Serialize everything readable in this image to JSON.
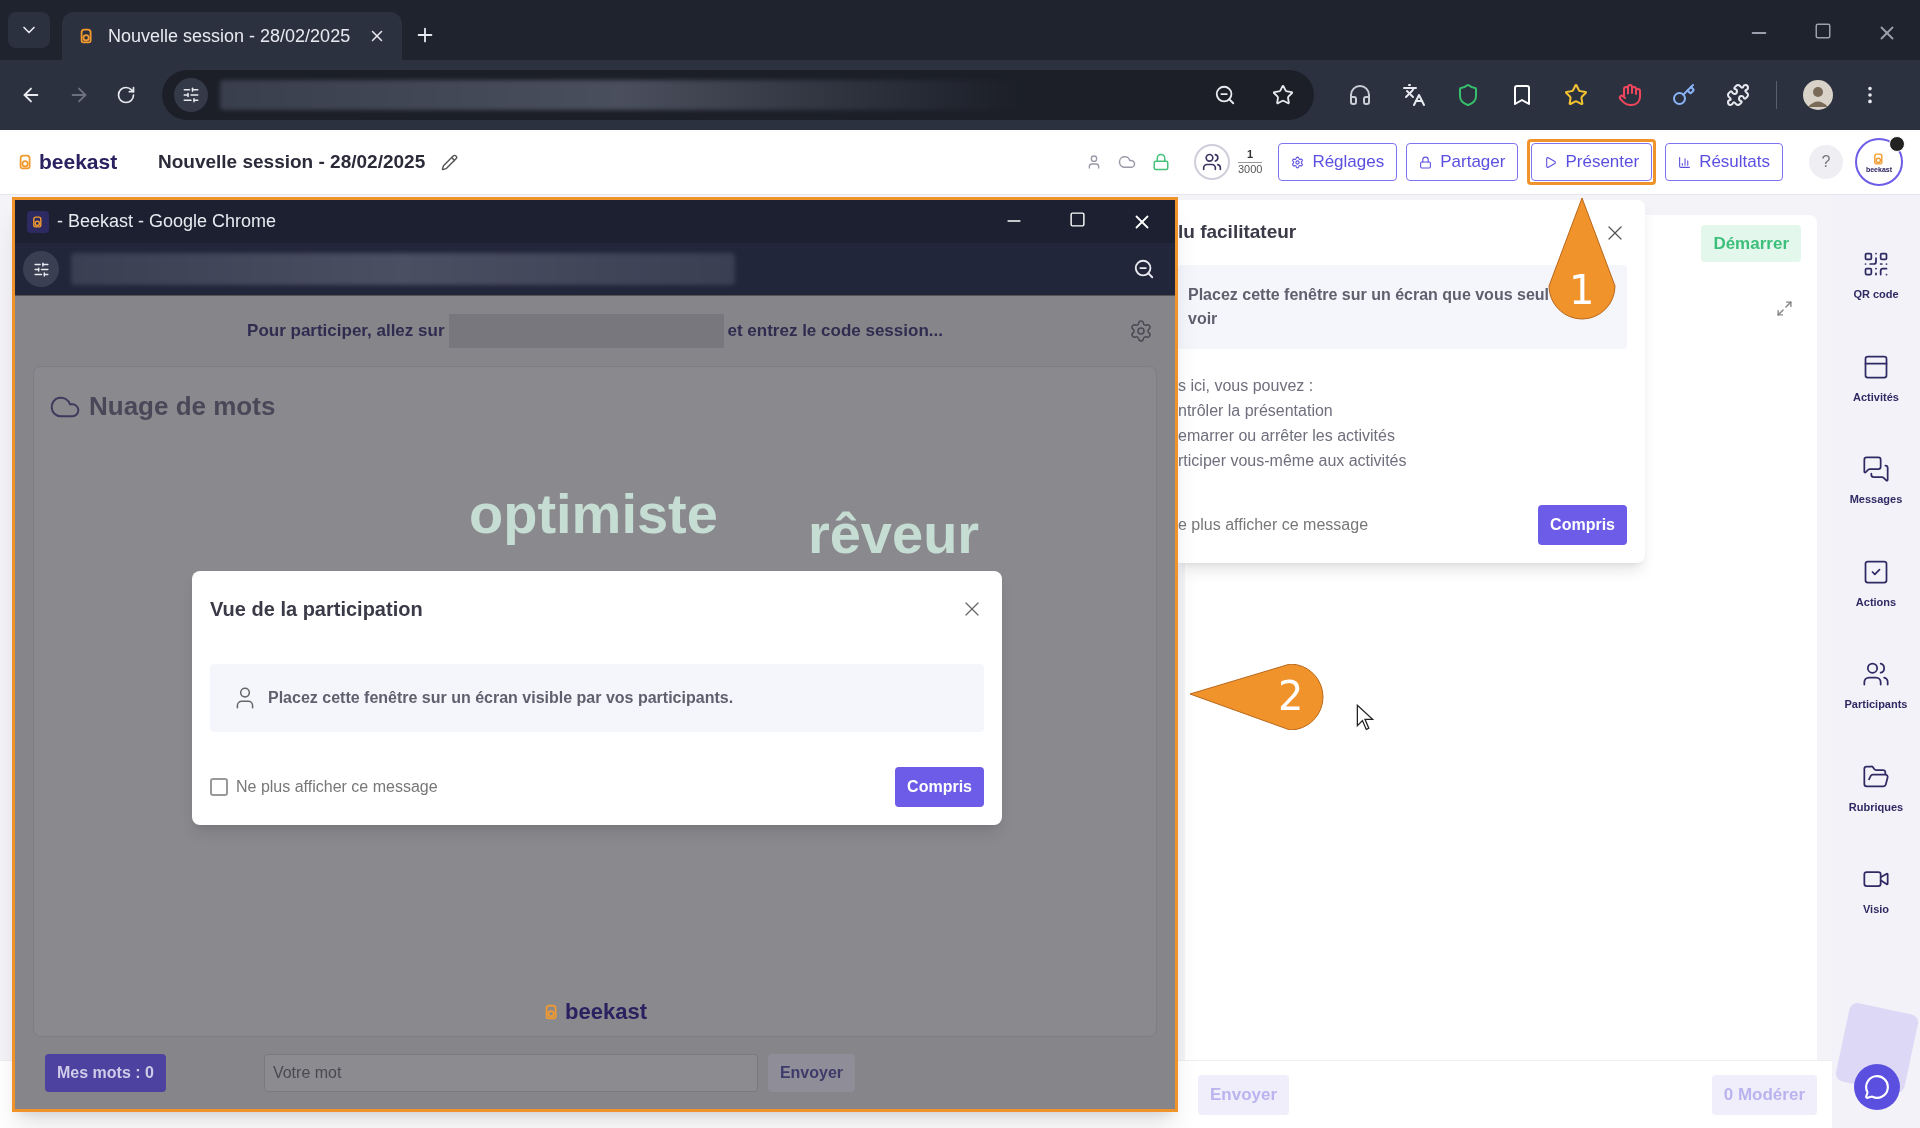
{
  "browser": {
    "tab_title": "Nouvelle session - 28/02/2025"
  },
  "header": {
    "logo": "beekast",
    "title": "Nouvelle session - 28/02/2025",
    "participants": {
      "count": "1",
      "max": "3000"
    },
    "buttons": [
      {
        "label": "Réglages",
        "highlighted": false
      },
      {
        "label": "Partager",
        "highlighted": false
      },
      {
        "label": "Présenter",
        "highlighted": true
      },
      {
        "label": "Résultats",
        "highlighted": false
      }
    ],
    "help": "?",
    "avatar": "beekast"
  },
  "main": {
    "start_button": "Démarrer",
    "send_button": "Envoyer",
    "moderate_button": "0 Modérer"
  },
  "facilitator_panel": {
    "title": "lu facilitateur",
    "notice_lines": [
      "Placez cette fenêtre sur un écran que vous seul",
      "voir"
    ],
    "intro": "s ici, vous pouvez :",
    "items": [
      "ntrôler la présentation",
      "emarrer ou arrêter les activités",
      "rticiper vous-même aux activités"
    ],
    "checkbox_label": "e plus afficher ce message",
    "confirm": "Compris"
  },
  "sidebar": {
    "items": [
      {
        "label": "QR code"
      },
      {
        "label": "Activités"
      },
      {
        "label": "Messages"
      },
      {
        "label": "Actions"
      },
      {
        "label": "Participants"
      },
      {
        "label": "Rubriques"
      },
      {
        "label": "Visio"
      }
    ]
  },
  "popup_window": {
    "title": "- Beekast - Google Chrome",
    "join_prefix": "Pour participer, allez sur",
    "join_suffix": "et entrez le code session...",
    "activity_title": "Nuage de mots",
    "words": [
      "optimiste",
      "rêveur"
    ],
    "logo": "beekast",
    "my_words": "Mes mots : 0",
    "input_placeholder": "Votre mot",
    "send": "Envoyer"
  },
  "dialog": {
    "title": "Vue de la participation",
    "notice": "Placez cette fenêtre sur un écran visible par vos participants.",
    "checkbox": {
      "label": "Ne plus afficher ce message",
      "checked": false
    },
    "confirm": "Compris"
  },
  "callouts": [
    {
      "number": "1"
    },
    {
      "number": "2"
    }
  ]
}
